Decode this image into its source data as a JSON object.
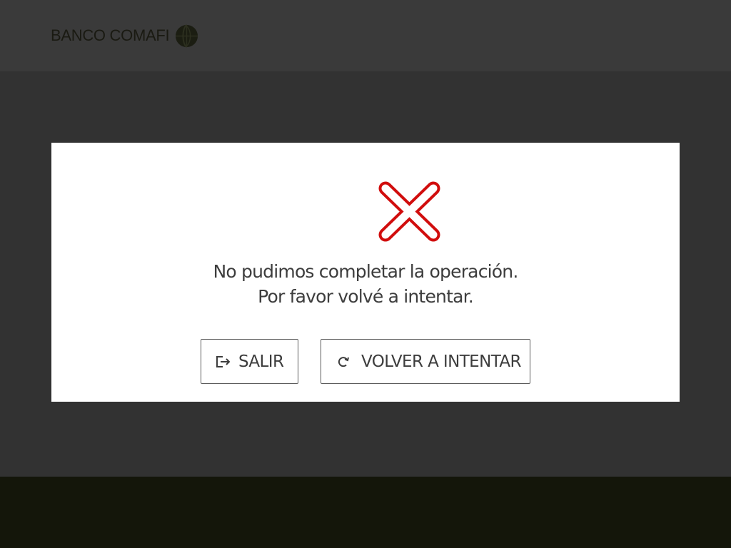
{
  "header": {
    "brand_name": "BANCO COMAFI",
    "logo_icon": "comafi-globe-icon"
  },
  "dialog": {
    "status_icon": "error-x-icon",
    "message_line_1": "No pudimos completar la operación.",
    "message_line_2": "Por favor volvé a intentar.",
    "exit_button": {
      "label": "SALIR",
      "icon": "exit-icon"
    },
    "retry_button": {
      "label": "VOLVER A INTENTAR",
      "icon": "refresh-icon"
    }
  },
  "colors": {
    "overlay": "#323232",
    "header": "#3a3a3a",
    "footer": "#14160a",
    "error_red": "#d10d0d",
    "text": "#3d3d3d",
    "dialog_bg": "#ffffff"
  }
}
